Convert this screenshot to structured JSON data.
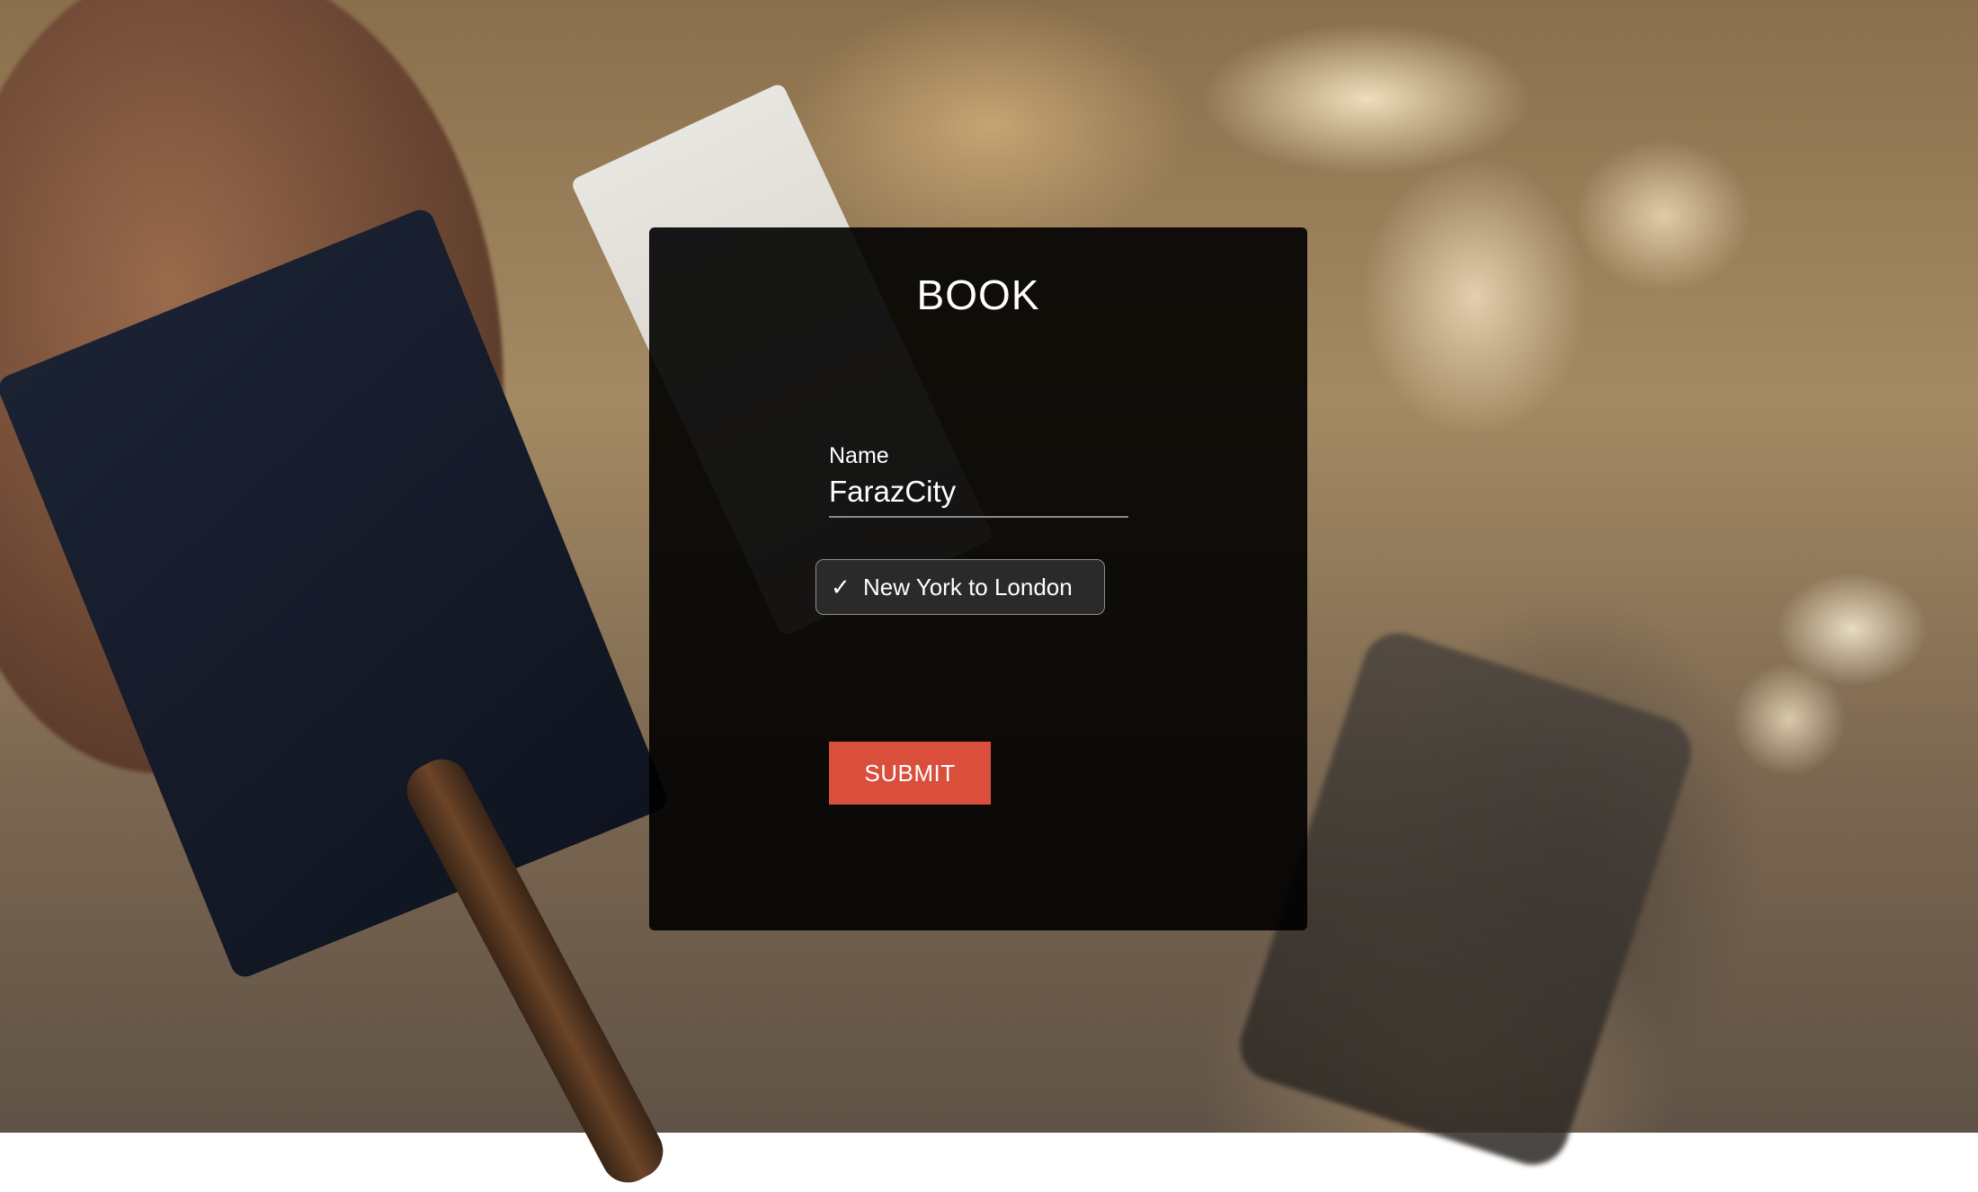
{
  "form": {
    "title": "BOOK",
    "name_label": "Name",
    "name_value": "FarazCity",
    "route_selected": "New York to London",
    "submit_label": "SUBMIT"
  },
  "colors": {
    "card_background": "#000000",
    "submit_button": "#d94f3c",
    "text": "#ffffff"
  },
  "icons": {
    "selected_option": "check-icon"
  }
}
